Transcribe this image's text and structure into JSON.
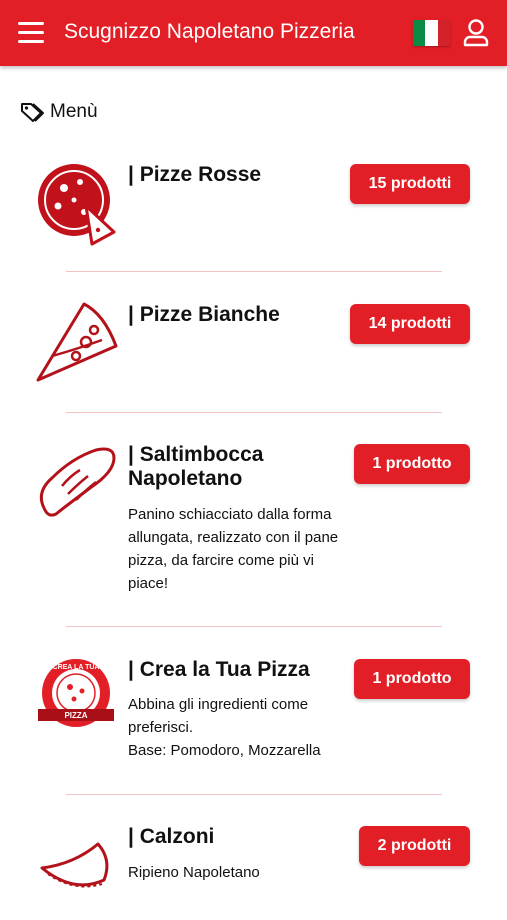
{
  "header": {
    "title": "Scugnizzo Napoletano Pizzeria",
    "menu_icon": "hamburger-icon",
    "language_flag": "italy-flag-icon",
    "user_icon": "user-icon",
    "brand_color": "#e21f26"
  },
  "section": {
    "icon": "tag-icon",
    "title": "Menù"
  },
  "categories": [
    {
      "icon": "pizza-icon",
      "name": "| Pizze Rosse",
      "description": "",
      "badge": "15 prodotti"
    },
    {
      "icon": "pizza-slice-icon",
      "name": "| Pizze Bianche",
      "description": "",
      "badge": "14 prodotti"
    },
    {
      "icon": "bread-icon",
      "name": "| Saltimbocca Napoletano",
      "description": "Panino schiacciato dalla forma allungata, realizzato con il pane pizza, da farcire come più vi piace!",
      "badge": "1 prodotto"
    },
    {
      "icon": "crea-la-tua-pizza-logo",
      "name": "| Crea la Tua Pizza",
      "description_lines": [
        "Abbina gli ingredienti come preferisci.",
        "Base: Pomodoro, Mozzarella"
      ],
      "badge": "1 prodotto",
      "logo_text_top": "CREA LA TUA",
      "logo_text_bottom": "PIZZA"
    },
    {
      "icon": "calzone-icon",
      "name": "| Calzoni",
      "description": "Ripieno Napoletano",
      "badge": "2 prodotti"
    }
  ]
}
